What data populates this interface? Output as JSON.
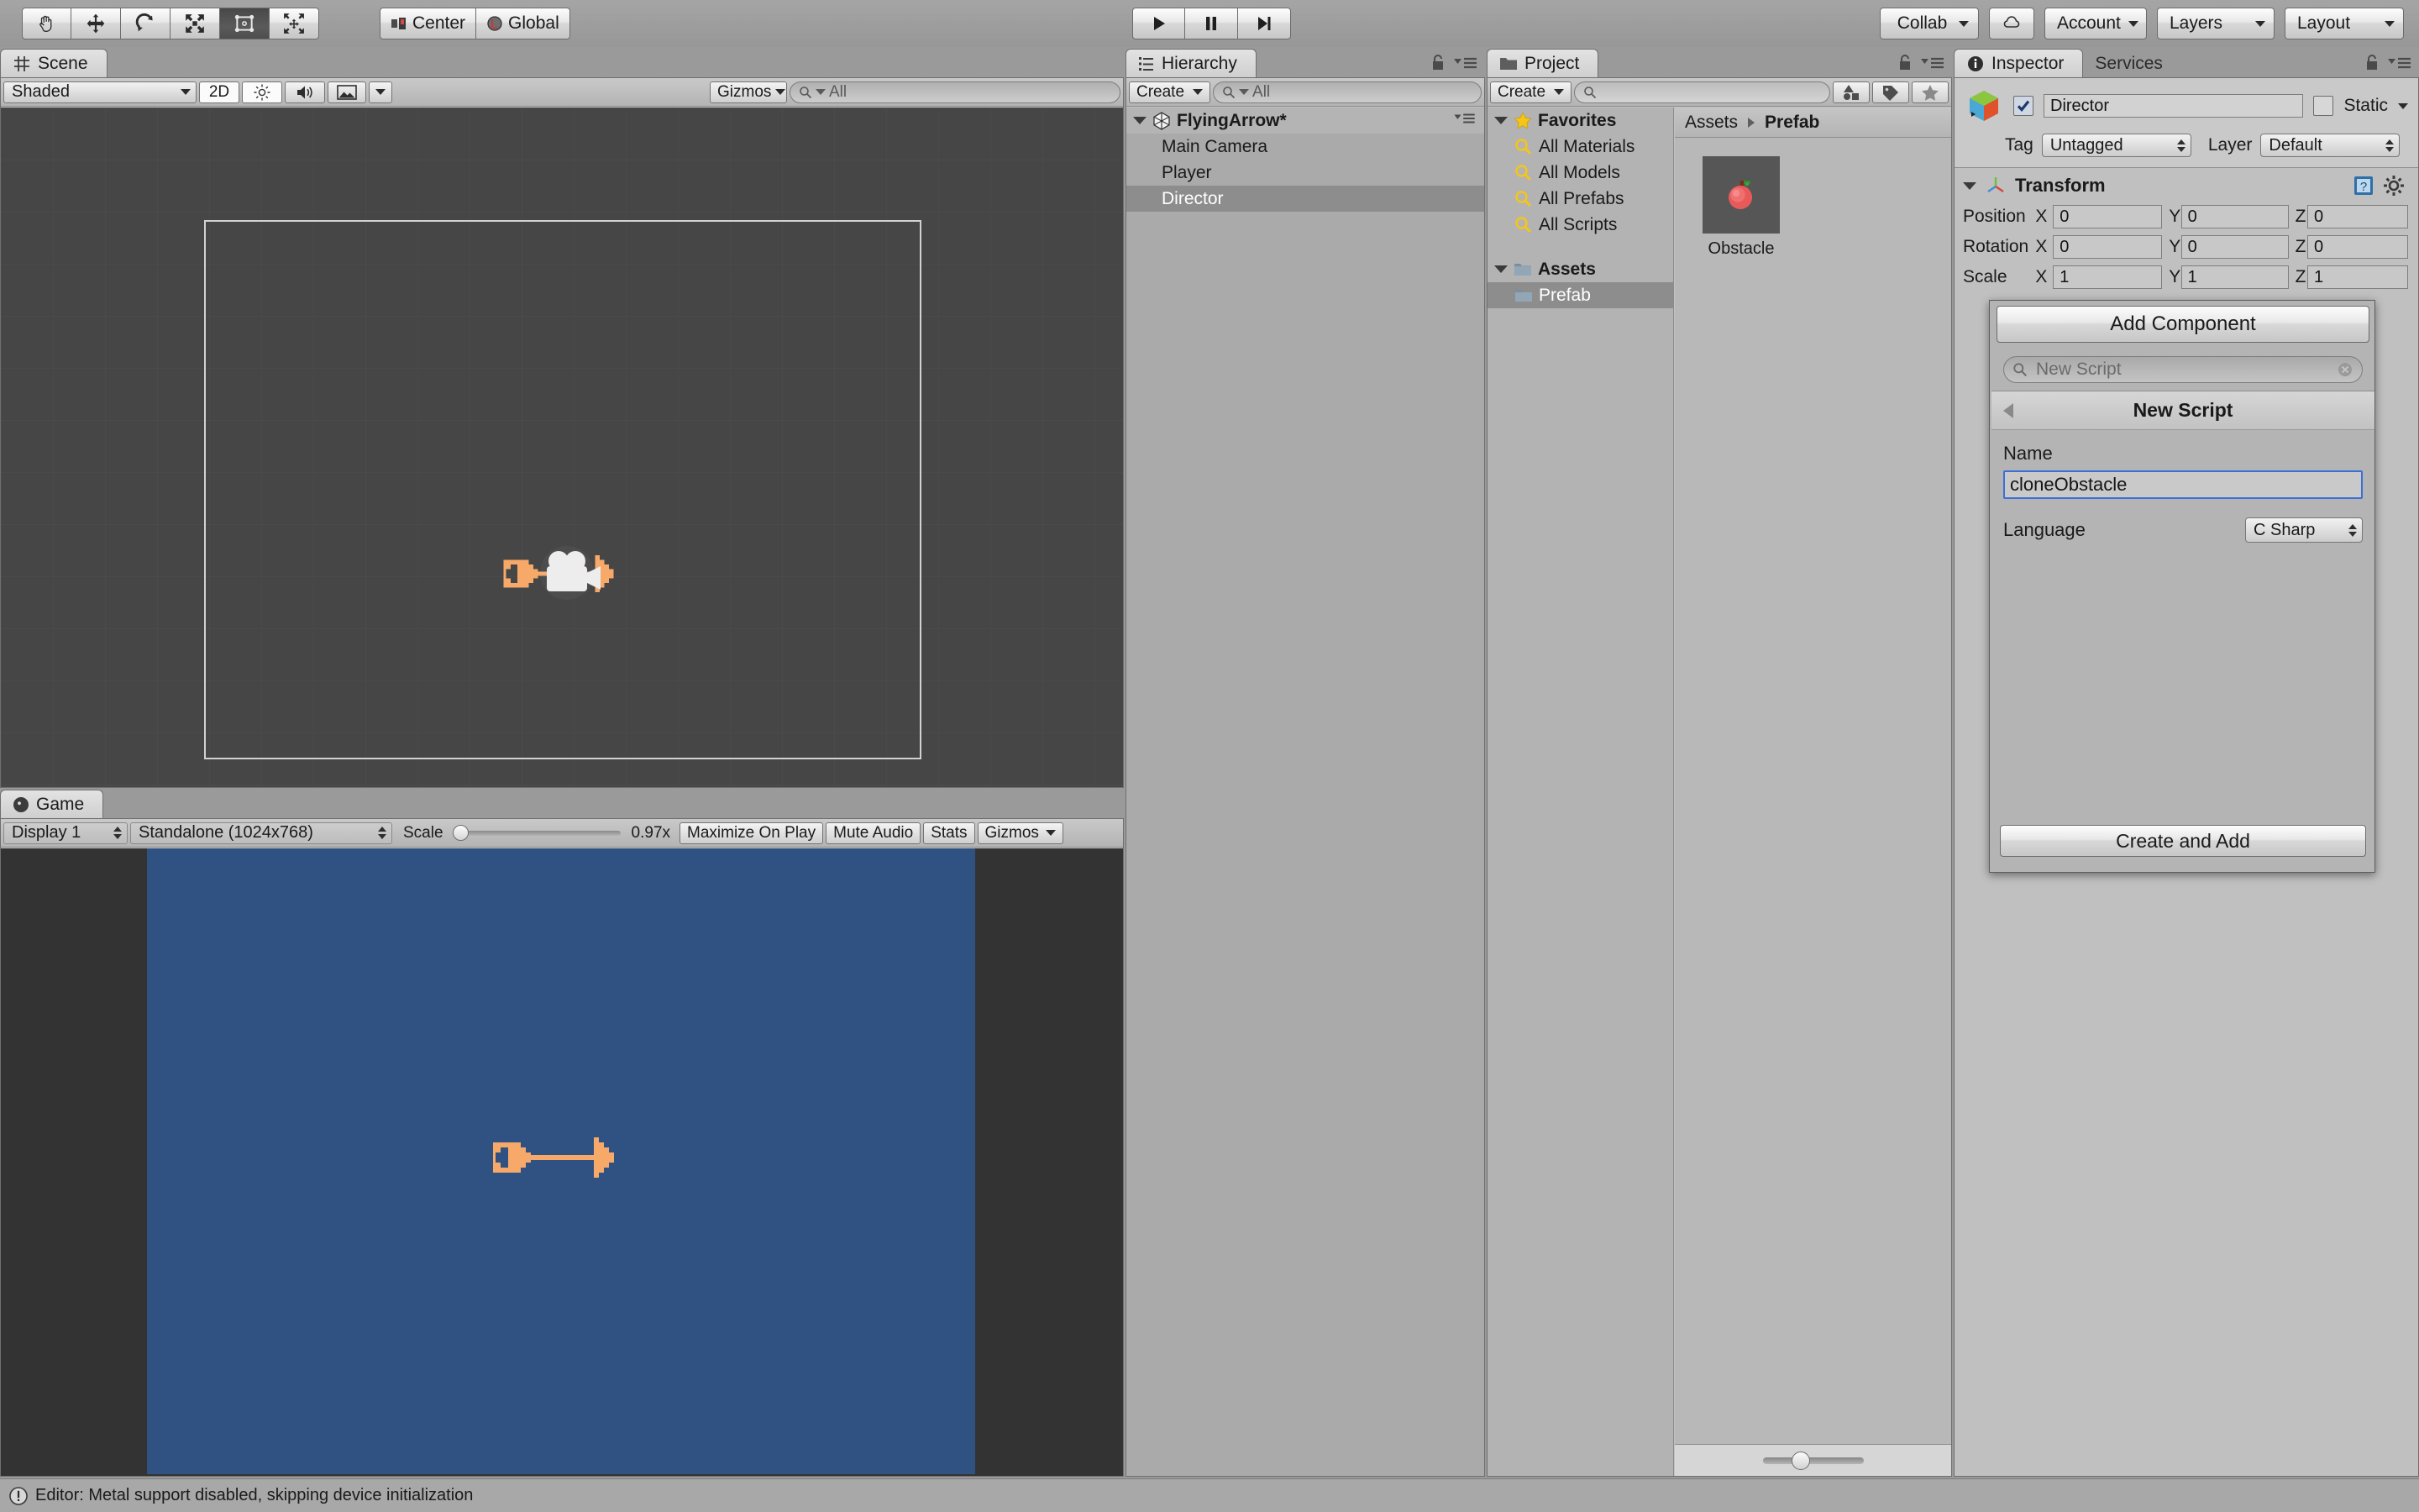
{
  "app": "Unity Editor",
  "toolbar": {
    "transform_tools": [
      {
        "name": "hand-tool",
        "label": "",
        "active": false
      },
      {
        "name": "move-tool",
        "label": "",
        "active": false
      },
      {
        "name": "rotate-tool",
        "label": "",
        "active": false
      },
      {
        "name": "scale-tool",
        "label": "",
        "active": false
      },
      {
        "name": "rect-tool",
        "label": "",
        "active": true
      },
      {
        "name": "transform-tool",
        "label": "",
        "active": false
      }
    ],
    "pivot_label": "Center",
    "handle_label": "Global",
    "play_label": "Play",
    "pause_label": "Pause",
    "step_label": "Step",
    "collab_label": "Collab",
    "cloud_label": "",
    "account_label": "Account",
    "layers_label": "Layers",
    "layout_label": "Layout"
  },
  "scene": {
    "tab_label": "Scene",
    "shading_mode": "Shaded",
    "toggle_2d": "2D",
    "lighting_icon": "sun-icon",
    "audio_icon": "audio-icon",
    "fx_icon": "image-icon",
    "gizmos_label": "Gizmos",
    "search_placeholder": "All"
  },
  "game": {
    "tab_label": "Game",
    "display_label": "Display 1",
    "resolution_label": "Standalone (1024x768)",
    "scale_label": "Scale",
    "scale_value": "0.97x",
    "maximize_label": "Maximize On Play",
    "mute_label": "Mute Audio",
    "stats_label": "Stats",
    "gizmos_label": "Gizmos",
    "background_color": "#2F5282"
  },
  "hierarchy": {
    "tab_label": "Hierarchy",
    "create_label": "Create",
    "search_placeholder": "All",
    "scene_name": "FlyingArrow*",
    "items": [
      {
        "label": "Main Camera",
        "selected": false
      },
      {
        "label": "Player",
        "selected": false
      },
      {
        "label": "Director",
        "selected": true
      }
    ]
  },
  "project": {
    "tab_label": "Project",
    "create_label": "Create",
    "search_placeholder": "",
    "favorites_label": "Favorites",
    "favorites": [
      "All Materials",
      "All Models",
      "All Prefabs",
      "All Scripts"
    ],
    "assets_label": "Assets",
    "folders": [
      {
        "label": "Prefab",
        "selected": true
      }
    ],
    "breadcrumb": [
      "Assets",
      "Prefab"
    ],
    "assets_items": [
      {
        "label": "Obstacle",
        "icon": "apple-sprite"
      }
    ]
  },
  "inspector": {
    "tab_label": "Inspector",
    "services_tab_label": "Services",
    "object_name": "Director",
    "object_enabled": true,
    "static_label": "Static",
    "static_checked": false,
    "tag_label": "Tag",
    "tag_value": "Untagged",
    "layer_label": "Layer",
    "layer_value": "Default",
    "transform": {
      "title": "Transform",
      "rows": [
        {
          "label": "Position",
          "x": "0",
          "y": "0",
          "z": "0"
        },
        {
          "label": "Rotation",
          "x": "0",
          "y": "0",
          "z": "0"
        },
        {
          "label": "Scale",
          "x": "1",
          "y": "1",
          "z": "1"
        }
      ],
      "axis_labels": [
        "X",
        "Y",
        "Z"
      ]
    },
    "add_component_label": "Add Component"
  },
  "add_component_popup": {
    "search_placeholder": "New Script",
    "header_title": "New Script",
    "name_label": "Name",
    "name_value": "cloneObstacle",
    "language_label": "Language",
    "language_value": "C Sharp",
    "create_button_label": "Create and Add"
  },
  "status_bar": {
    "message": "Editor: Metal support disabled, skipping device initialization",
    "icon": "warning-icon"
  }
}
